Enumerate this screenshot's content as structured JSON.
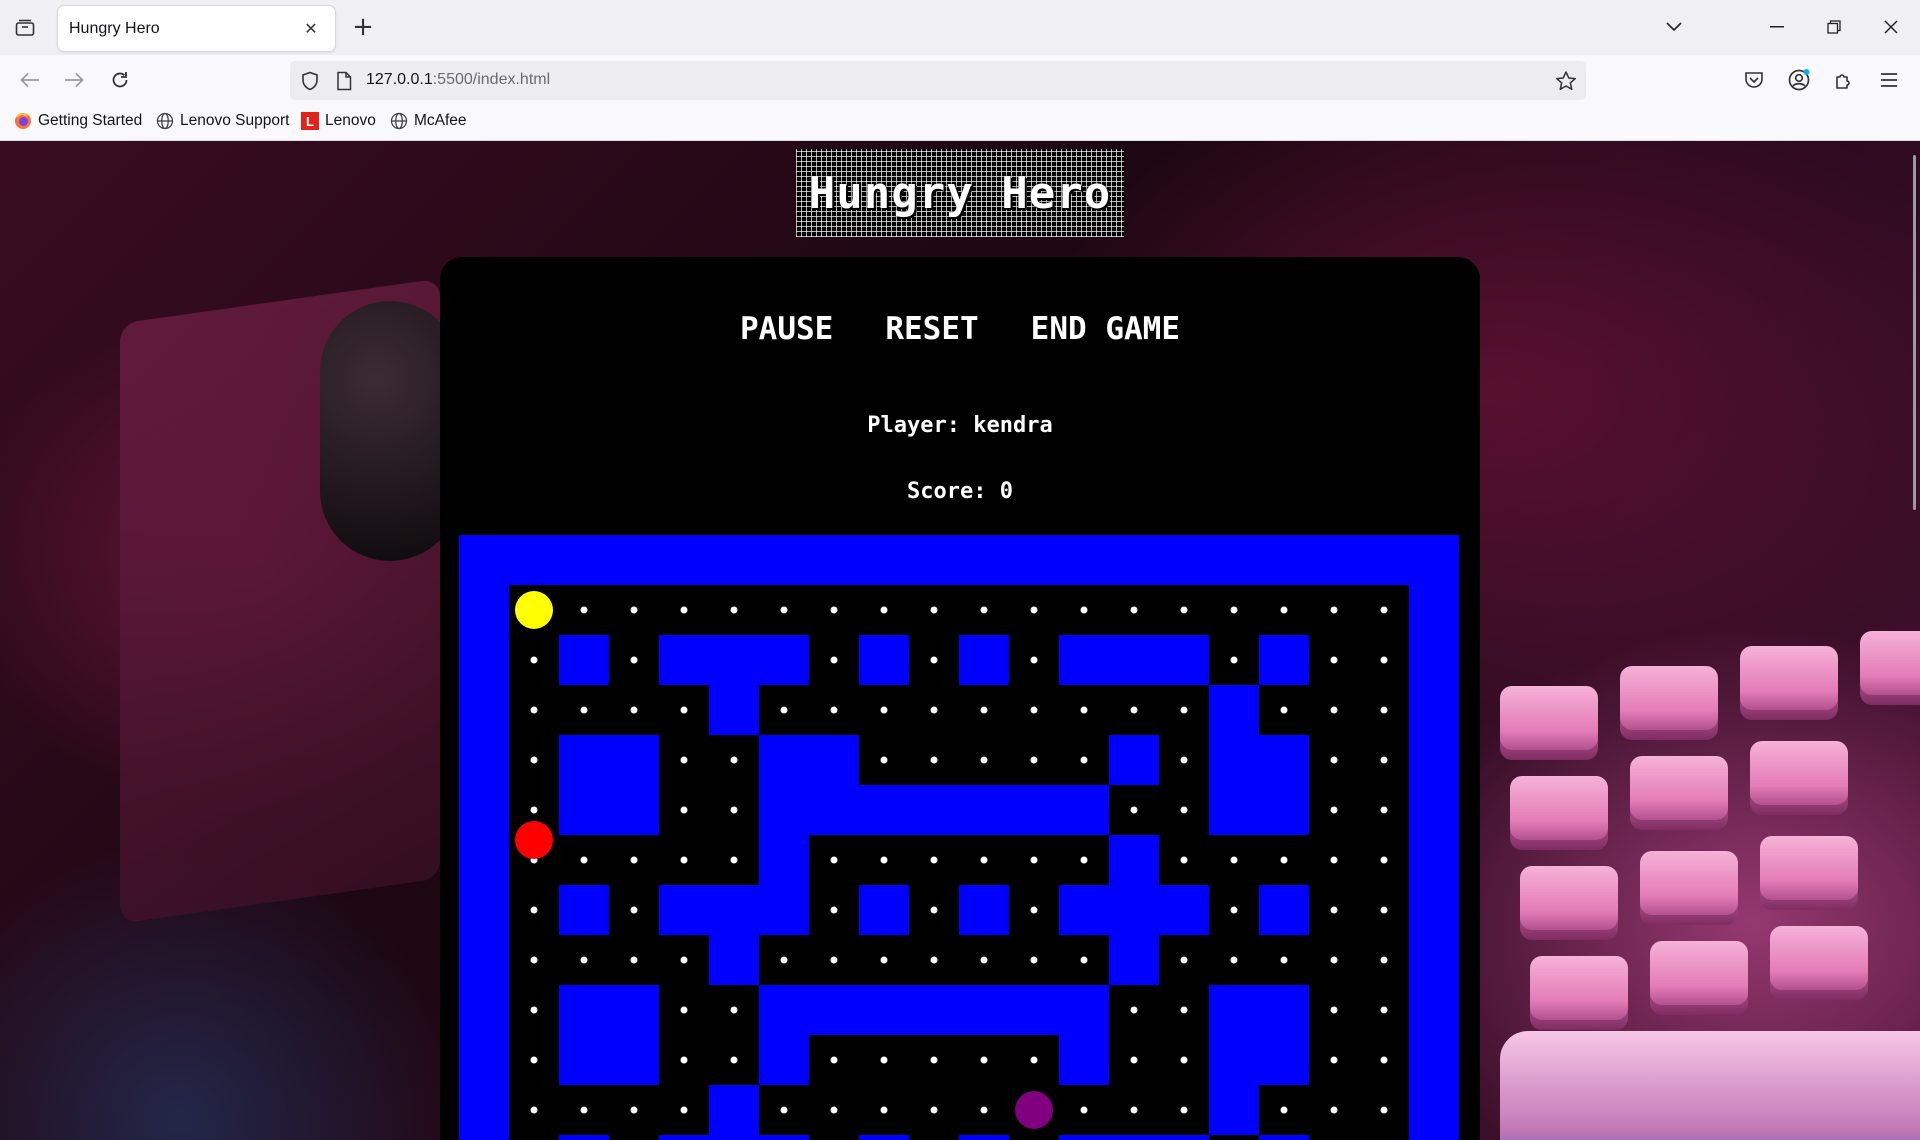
{
  "browser": {
    "tab_title": "Hungry Hero",
    "url_host": "127.0.0.1",
    "url_path": ":5500/index.html",
    "bookmarks": [
      "Getting Started",
      "Lenovo Support",
      "Lenovo",
      "McAfee"
    ]
  },
  "game": {
    "logo_text": "Hungry Hero",
    "controls": {
      "pause": "PAUSE",
      "reset": "RESET",
      "end": "END GAME"
    },
    "player_label": "Player: kendra",
    "score_label": "Score: 0",
    "colors": {
      "wall": "#0000ff",
      "floor": "#000000",
      "dot": "#ffffff",
      "hero": "#ffff00",
      "ghost_red": "#ff0000",
      "ghost_purple": "#800080"
    },
    "grid": [
      "WWWWWWWWWWWWWWWWWWWW",
      "WP.................W",
      "W.W.WWW.W.W.WWW.W..W",
      "W....W.........W...W",
      "W.WW..WW.....W.WW..W",
      "W.WW..WWWWWWW..WW..W",
      "W.....W......W.....W",
      "W.W.WWW.W.W.WWW.W..W",
      "W....W.......W.....W",
      "W.WW..WWWWWWW..WW..W",
      "W.WW..W.....W..WW..W",
      "W....W.........W...W",
      "W.W.WWW.W.W.WWW.W..W"
    ],
    "hero": {
      "row": 1,
      "col": 1
    },
    "ghosts": [
      {
        "color": "red",
        "row": 5.6,
        "col": 1
      },
      {
        "color": "purple",
        "row": 11,
        "col": 11
      }
    ]
  }
}
